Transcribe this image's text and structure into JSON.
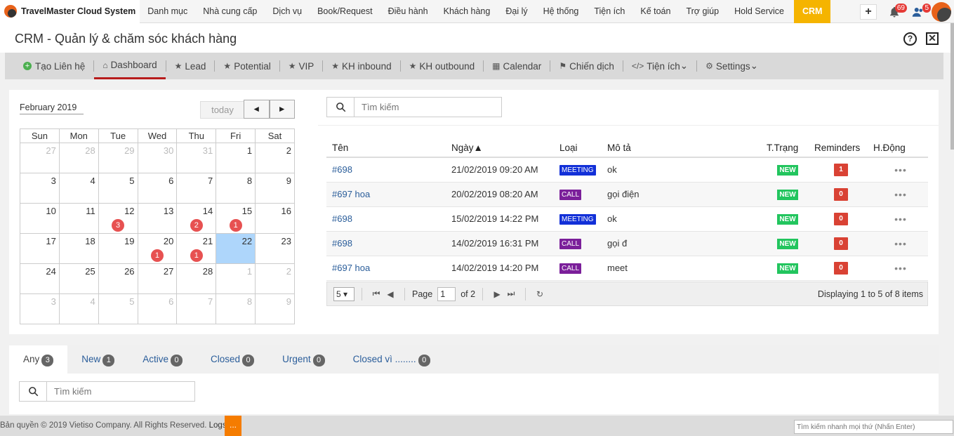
{
  "brand": "TravelMaster Cloud System",
  "menu": [
    "Danh mục",
    "Nhà cung cấp",
    "Dịch vụ",
    "Book/Request",
    "Điều hành",
    "Khách hàng",
    "Đại lý",
    "Hệ thống",
    "Tiện ích",
    "Kế toán",
    "Trợ giúp",
    "Hold Service",
    "CRM"
  ],
  "notifications": {
    "bell_count": "69",
    "users_count": "5",
    "plus": "+"
  },
  "page_title": "CRM - Quản lý & chăm sóc khách hàng",
  "help_icon_text": "?",
  "close_icon_text": "✕",
  "tabs": [
    {
      "label": "Tạo Liên hệ",
      "icon": "plus-circle-icon"
    },
    {
      "label": "Dashboard",
      "icon": "home-icon"
    },
    {
      "label": "Lead",
      "icon": "star-icon"
    },
    {
      "label": "Potential",
      "icon": "star-icon"
    },
    {
      "label": "VIP",
      "icon": "star-icon"
    },
    {
      "label": "KH inbound",
      "icon": "star-icon"
    },
    {
      "label": "KH outbound",
      "icon": "star-icon"
    },
    {
      "label": "Calendar",
      "icon": "calendar-icon"
    },
    {
      "label": "Chiến dịch",
      "icon": "flag-icon"
    },
    {
      "label": "Tiện ích",
      "icon": "code-icon"
    },
    {
      "label": "Settings",
      "icon": "gears-icon"
    }
  ],
  "calendar": {
    "title": "February 2019",
    "today_label": "today",
    "prev": "◄",
    "next": "►",
    "weekdays": [
      "Sun",
      "Mon",
      "Tue",
      "Wed",
      "Thu",
      "Fri",
      "Sat"
    ],
    "weeks": [
      [
        {
          "d": "27",
          "o": true
        },
        {
          "d": "28",
          "o": true
        },
        {
          "d": "29",
          "o": true
        },
        {
          "d": "30",
          "o": true
        },
        {
          "d": "31",
          "o": true
        },
        {
          "d": "1"
        },
        {
          "d": "2"
        }
      ],
      [
        {
          "d": "3"
        },
        {
          "d": "4"
        },
        {
          "d": "5"
        },
        {
          "d": "6"
        },
        {
          "d": "7"
        },
        {
          "d": "8"
        },
        {
          "d": "9"
        }
      ],
      [
        {
          "d": "10"
        },
        {
          "d": "11"
        },
        {
          "d": "12",
          "b": "3"
        },
        {
          "d": "13"
        },
        {
          "d": "14",
          "b": "2"
        },
        {
          "d": "15",
          "b": "1"
        },
        {
          "d": "16"
        }
      ],
      [
        {
          "d": "17"
        },
        {
          "d": "18"
        },
        {
          "d": "19"
        },
        {
          "d": "20",
          "b": "1"
        },
        {
          "d": "21",
          "b": "1"
        },
        {
          "d": "22",
          "t": true
        },
        {
          "d": "23"
        }
      ],
      [
        {
          "d": "24"
        },
        {
          "d": "25"
        },
        {
          "d": "26"
        },
        {
          "d": "27"
        },
        {
          "d": "28"
        },
        {
          "d": "1",
          "o": true
        },
        {
          "d": "2",
          "o": true
        }
      ],
      [
        {
          "d": "3",
          "o": true
        },
        {
          "d": "4",
          "o": true
        },
        {
          "d": "5",
          "o": true
        },
        {
          "d": "6",
          "o": true
        },
        {
          "d": "7",
          "o": true
        },
        {
          "d": "8",
          "o": true
        },
        {
          "d": "9",
          "o": true
        }
      ]
    ]
  },
  "events": {
    "search_placeholder": "Tìm kiếm",
    "columns": [
      "Tên",
      "Ngày▲",
      "Loại",
      "Mô tả",
      "T.Trạng",
      "Reminders",
      "H.Động"
    ],
    "rows": [
      {
        "name": "#698",
        "date": "21/02/2019 09:20 AM",
        "type": "MEETING",
        "desc": "ok",
        "status": "NEW",
        "reminders": "1",
        "action": "•••"
      },
      {
        "name": "#697 hoa",
        "date": "20/02/2019 08:20 AM",
        "type": "CALL",
        "desc": "gọi điện",
        "status": "NEW",
        "reminders": "0",
        "action": "•••"
      },
      {
        "name": "#698",
        "date": "15/02/2019 14:22 PM",
        "type": "MEETING",
        "desc": "ok",
        "status": "NEW",
        "reminders": "0",
        "action": "•••"
      },
      {
        "name": "#698",
        "date": "14/02/2019 16:31 PM",
        "type": "CALL",
        "desc": "gọi đ",
        "status": "NEW",
        "reminders": "0",
        "action": "•••"
      },
      {
        "name": "#697 hoa",
        "date": "14/02/2019 14:20 PM",
        "type": "CALL",
        "desc": "meet",
        "status": "NEW",
        "reminders": "0",
        "action": "•••"
      }
    ],
    "pager": {
      "page_size": "5",
      "page_label": "Page",
      "page": "1",
      "of_label": "of 2",
      "display": "Displaying 1 to 5 of 8 items"
    }
  },
  "filters": {
    "tabs": [
      {
        "label": "Any",
        "count": "3"
      },
      {
        "label": "New",
        "count": "1"
      },
      {
        "label": "Active",
        "count": "0"
      },
      {
        "label": "Closed",
        "count": "0"
      },
      {
        "label": "Urgent",
        "count": "0"
      },
      {
        "label": "Closed vì ........",
        "count": "0"
      }
    ],
    "search_placeholder": "Tìm kiếm"
  },
  "footer": {
    "copyright": "Bản quyền © 2019 Vietiso Company. All Rights Reserved.",
    "logs": "Logs.",
    "button": "...",
    "quick_search_placeholder": "Tìm kiếm nhanh mọi thứ (Nhấn Enter)"
  }
}
